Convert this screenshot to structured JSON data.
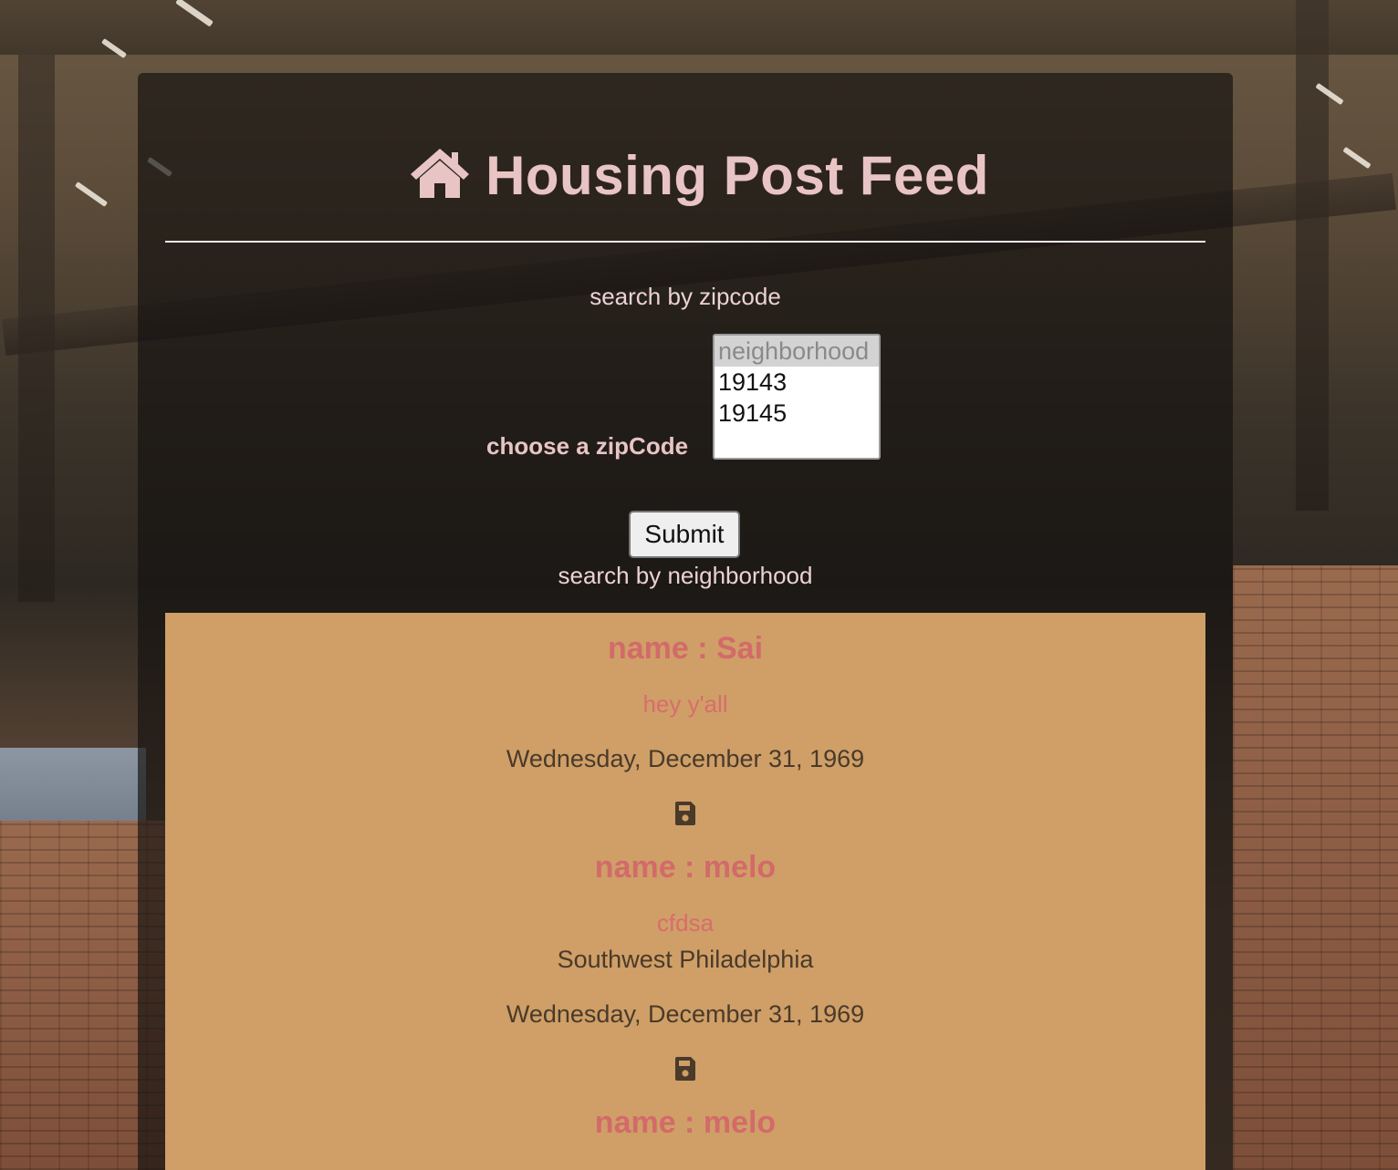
{
  "header": {
    "title": "Housing Post Feed",
    "icon": "home-icon"
  },
  "search": {
    "zipcode_heading": "search by zipcode",
    "zip_label": "choose a zipCode",
    "zip_options": [
      "neighborhood",
      "19143",
      "19145"
    ],
    "zip_selected": "neighborhood",
    "submit_label": "Submit",
    "neighborhood_heading": "search by neighborhood"
  },
  "posts": [
    {
      "name": "name : Sai",
      "message": "hey y'all",
      "date": "Wednesday, December 31, 1969"
    },
    {
      "name": "name : melo",
      "message": "cfdsa",
      "neighborhood": "Southwest Philadelphia",
      "date": "Wednesday, December 31, 1969"
    },
    {
      "name": "name : melo"
    }
  ],
  "colors": {
    "title": "#e8c4c4",
    "feed_bg": "#cf9f67",
    "name_text": "#d36a6a",
    "body_text": "#4a3a2a"
  }
}
